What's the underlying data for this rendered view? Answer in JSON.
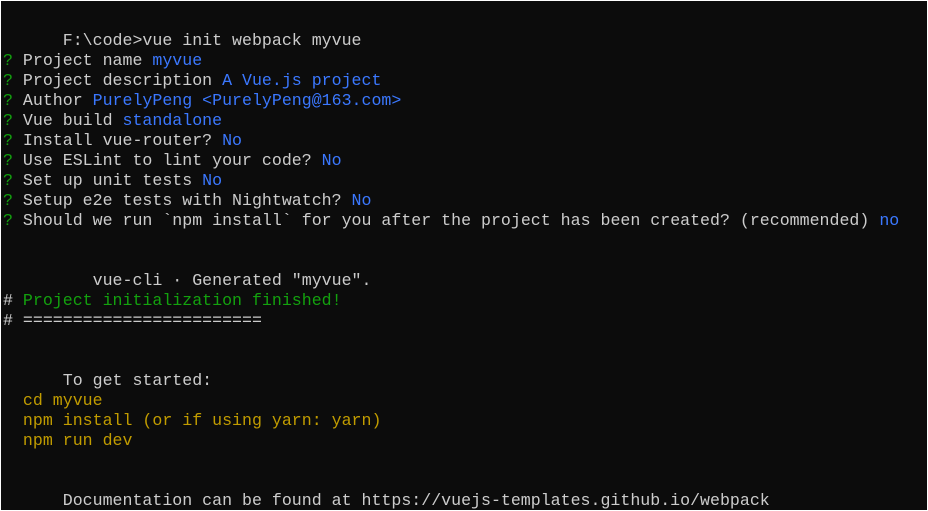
{
  "colors": {
    "background": "#0c0c0c",
    "foreground": "#cccccc",
    "prompt_marker": "#13a10e",
    "answer": "#3b78ff",
    "command_hint": "#c19c00"
  },
  "command_line": "F:\\code>vue init webpack myvue",
  "questions": [
    {
      "marker": "?",
      "question": " Project name ",
      "answer": "myvue"
    },
    {
      "marker": "?",
      "question": " Project description ",
      "answer": "A Vue.js project"
    },
    {
      "marker": "?",
      "question": " Author ",
      "answer": "PurelyPeng <PurelyPeng@163.com>"
    },
    {
      "marker": "?",
      "question": " Vue build ",
      "answer": "standalone"
    },
    {
      "marker": "?",
      "question": " Install vue-router? ",
      "answer": "No"
    },
    {
      "marker": "?",
      "question": " Use ESLint to lint your code? ",
      "answer": "No"
    },
    {
      "marker": "?",
      "question": " Set up unit tests ",
      "answer": "No"
    },
    {
      "marker": "?",
      "question": " Setup e2e tests with Nightwatch? ",
      "answer": "No"
    },
    {
      "marker": "?",
      "question": " Should we run `npm install` for you after the project has been created? (recommended) ",
      "answer": "no"
    }
  ],
  "generated_line": "   vue-cli · Generated \"myvue\".",
  "init_finished": {
    "marker": "#",
    "text": " Project initialization finished!"
  },
  "separator": {
    "marker": "#",
    "text": " ========================"
  },
  "get_started": "To get started:",
  "steps": [
    "  cd myvue",
    "  npm install (or if using yarn: yarn)",
    "  npm run dev"
  ],
  "documentation": "Documentation can be found at https://vuejs-templates.github.io/webpack"
}
